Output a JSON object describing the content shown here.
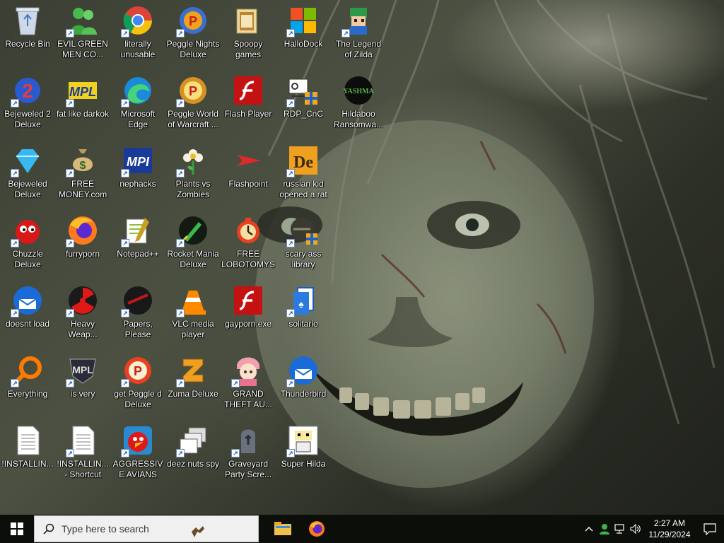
{
  "desktop": {
    "icons": [
      {
        "label": "Recycle Bin",
        "icon": "recycle-bin-icon",
        "shortcut": false
      },
      {
        "label": "EVIL GREEN MEN CO...",
        "icon": "green-men-icon",
        "shortcut": true
      },
      {
        "label": "literally unusable",
        "icon": "chrome-icon",
        "shortcut": true
      },
      {
        "label": "Peggle Nights Deluxe",
        "icon": "peggle-nights-icon",
        "shortcut": true
      },
      {
        "label": "Spoopy games",
        "icon": "folder-icon",
        "shortcut": false
      },
      {
        "label": "HalloDock",
        "icon": "windows-logo-icon",
        "shortcut": true
      },
      {
        "label": "The Legend of Zilda",
        "icon": "zelda-character-icon",
        "shortcut": true
      },
      {
        "label": "Bejeweled 2 Deluxe",
        "icon": "bejeweled2-icon",
        "shortcut": true
      },
      {
        "label": "fat like darkok",
        "icon": "mpl-logo-icon",
        "shortcut": true
      },
      {
        "label": "Microsoft Edge",
        "icon": "edge-icon",
        "shortcut": true
      },
      {
        "label": "Peggle World of Warcraft ...",
        "icon": "peggle-wow-icon",
        "shortcut": true
      },
      {
        "label": "Flash Player",
        "icon": "flash-icon",
        "shortcut": false
      },
      {
        "label": "RDP_CnC",
        "icon": "rdp-icon",
        "shortcut": true
      },
      {
        "label": "Hildaboo Ransomwa...",
        "icon": "yashma-icon",
        "shortcut": false
      },
      {
        "label": "Bejeweled Deluxe",
        "icon": "gem-icon",
        "shortcut": true
      },
      {
        "label": "FREE MONEY.com",
        "icon": "money-bag-icon",
        "shortcut": true
      },
      {
        "label": "nephacks",
        "icon": "mpi-logo-icon",
        "shortcut": true
      },
      {
        "label": "Plants vs Zombies",
        "icon": "flower-icon",
        "shortcut": true
      },
      {
        "label": "Flashpoint",
        "icon": "flashpoint-icon",
        "shortcut": false
      },
      {
        "label": "russian kid opened a rat",
        "icon": "dc-logo-icon",
        "shortcut": true
      },
      {
        "label": "Chuzzle Deluxe",
        "icon": "chuzzle-icon",
        "shortcut": true
      },
      {
        "label": "furryporn",
        "icon": "firefox-icon",
        "shortcut": true
      },
      {
        "label": "Notepad++",
        "icon": "notepadpp-icon",
        "shortcut": true
      },
      {
        "label": "Rocket Mania Deluxe",
        "icon": "rocket-icon",
        "shortcut": true
      },
      {
        "label": "FREE LOBOTOMYS",
        "icon": "lobotomy-icon",
        "shortcut": false
      },
      {
        "label": "scary ass library",
        "icon": "library-icon",
        "shortcut": true
      },
      {
        "label": "doesnt load",
        "icon": "thunderbird-icon",
        "shortcut": true
      },
      {
        "label": "Heavy Weap...",
        "icon": "radiation-icon",
        "shortcut": true
      },
      {
        "label": "Papers, Please",
        "icon": "papers-please-icon",
        "shortcut": true
      },
      {
        "label": "VLC media player",
        "icon": "vlc-cone-icon",
        "shortcut": true
      },
      {
        "label": "gayporn.exe",
        "icon": "flash-icon",
        "shortcut": false
      },
      {
        "label": "solitario",
        "icon": "solitaire-icon",
        "shortcut": true
      },
      {
        "label": "Everything",
        "icon": "magnifier-icon",
        "shortcut": true
      },
      {
        "label": "is very",
        "icon": "mpl-shield-icon",
        "shortcut": true
      },
      {
        "label": "get Peggle d Deluxe",
        "icon": "peggle-deluxe-icon",
        "shortcut": true
      },
      {
        "label": "Zuma Deluxe",
        "icon": "zuma-icon",
        "shortcut": true
      },
      {
        "label": "GRAND THEFT AU...",
        "icon": "anime-girl-icon",
        "shortcut": true
      },
      {
        "label": "Thunderbird",
        "icon": "thunderbird-icon",
        "shortcut": true
      },
      {
        "label": "!INSTALLIN...",
        "icon": "document-icon",
        "shortcut": false
      },
      {
        "label": "!INSTALLIN... - Shortcut",
        "icon": "document-icon",
        "shortcut": true
      },
      {
        "label": "AGGRESSIVE AVIANS",
        "icon": "angry-bird-icon",
        "shortcut": true
      },
      {
        "label": "deez nuts spy",
        "icon": "windows-stack-icon",
        "shortcut": true
      },
      {
        "label": "Graveyard Party Scre...",
        "icon": "graveyard-icon",
        "shortcut": true
      },
      {
        "label": "Super Hilda",
        "icon": "pixel-character-icon",
        "shortcut": true
      }
    ]
  },
  "taskbar": {
    "search_placeholder": "Type here to search",
    "pinned": [
      {
        "name": "file-explorer-icon"
      },
      {
        "name": "firefox-icon"
      }
    ],
    "clock": {
      "time": "2:27 AM",
      "date": "11/29/2024"
    }
  },
  "colors": {
    "taskbar": "#0c0e0a",
    "search_bg": "#f0f0f0",
    "icon_label": "#ffffff"
  }
}
